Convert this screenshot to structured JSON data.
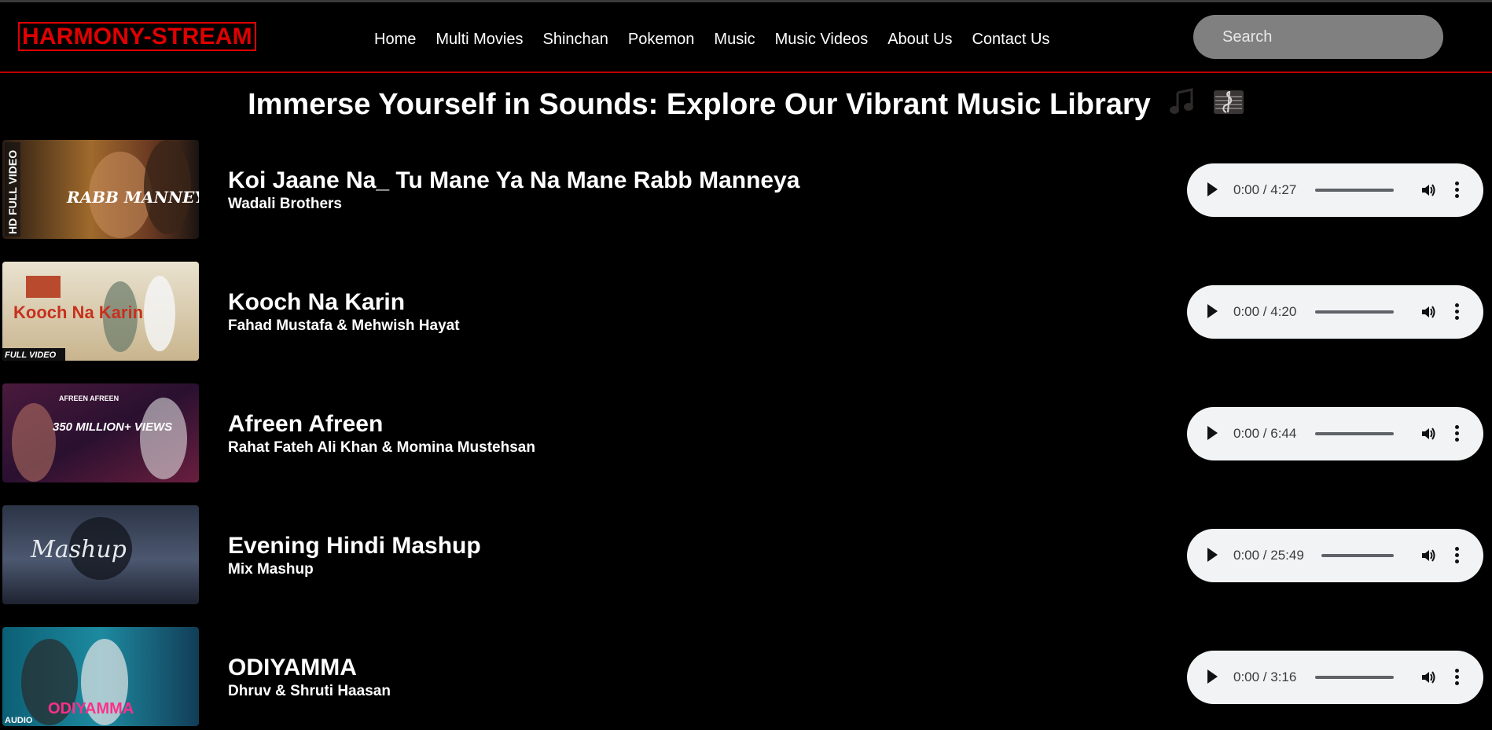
{
  "logo": "HARMONY-STREAM",
  "nav": [
    "Home",
    "Multi Movies",
    "Shinchan",
    "Pokemon",
    "Music",
    "Music Videos",
    "About Us",
    "Contact Us"
  ],
  "search": {
    "placeholder": "Search"
  },
  "heading": "Immerse Yourself in Sounds: Explore Our Vibrant Music Library",
  "heading_icons": [
    "musical-notes-icon",
    "musical-score-icon"
  ],
  "songs": [
    {
      "title": "Koi Jaane Na_ Tu Mane Ya Na Mane Rabb Manneya",
      "artist": "Wadali Brothers",
      "time": "0:00 / 4:27",
      "thumb_text": "RABB MANNEYA",
      "thumb_badge": "HD FULL VIDEO"
    },
    {
      "title": "Kooch Na Karin",
      "artist": "Fahad Mustafa & Mehwish Hayat",
      "time": "0:00 / 4:20",
      "thumb_text": "Kooch Na Karin",
      "thumb_badge": "FULL VIDEO"
    },
    {
      "title": "Afreen Afreen",
      "artist": "Rahat Fateh Ali Khan & Momina Mustehsan",
      "time": "0:00 / 6:44",
      "thumb_text": "350 MILLION+ VIEWS",
      "thumb_badge": "AFREEN AFREEN"
    },
    {
      "title": "Evening Hindi Mashup",
      "artist": "Mix Mashup",
      "time": "0:00 / 25:49",
      "thumb_text": "Mashup",
      "thumb_badge": ""
    },
    {
      "title": "ODIYAMMA",
      "artist": "Dhruv & Shruti Haasan",
      "time": "0:00 / 3:16",
      "thumb_text": "ODIYAMMA",
      "thumb_badge": "AUDIO"
    }
  ],
  "colors": {
    "accent": "#e00000",
    "background": "#000000",
    "player": "#f1f3f4",
    "search": "#808080"
  }
}
